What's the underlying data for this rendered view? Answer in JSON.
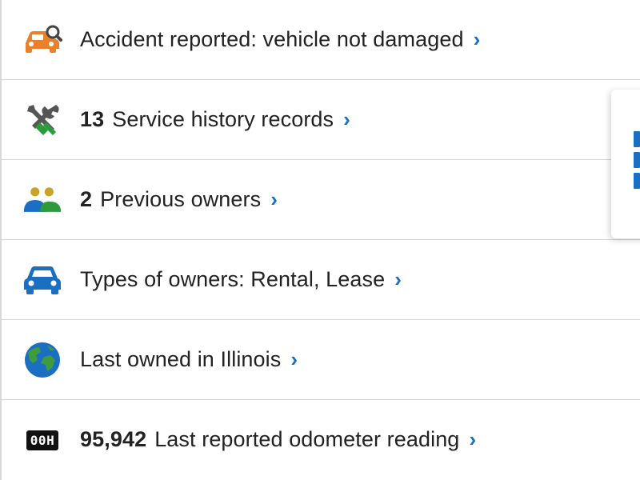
{
  "rows": [
    {
      "icon": "car-search-icon",
      "count": "",
      "label": "Accident reported: vehicle not damaged"
    },
    {
      "icon": "wrench-screwdriver-icon",
      "count": "13",
      "label": "Service history records"
    },
    {
      "icon": "people-icon",
      "count": "2",
      "label": "Previous owners"
    },
    {
      "icon": "car-icon",
      "count": "",
      "label": "Types of owners: Rental, Lease"
    },
    {
      "icon": "globe-icon",
      "count": "",
      "label": "Last owned in Illinois"
    },
    {
      "icon": "odometer-icon",
      "count": "95,942",
      "label": "Last reported odometer reading"
    }
  ],
  "chevron": "›",
  "odometer_badge": "00H",
  "colors": {
    "accent": "#1a6fc2",
    "accident": "#e8822a",
    "tools": "#555555",
    "tools_green": "#2e9a3e",
    "people_blue": "#1a6fc2",
    "people_gold": "#c9a227",
    "globe_blue": "#1a6fc2",
    "globe_green": "#3f9b3f"
  }
}
